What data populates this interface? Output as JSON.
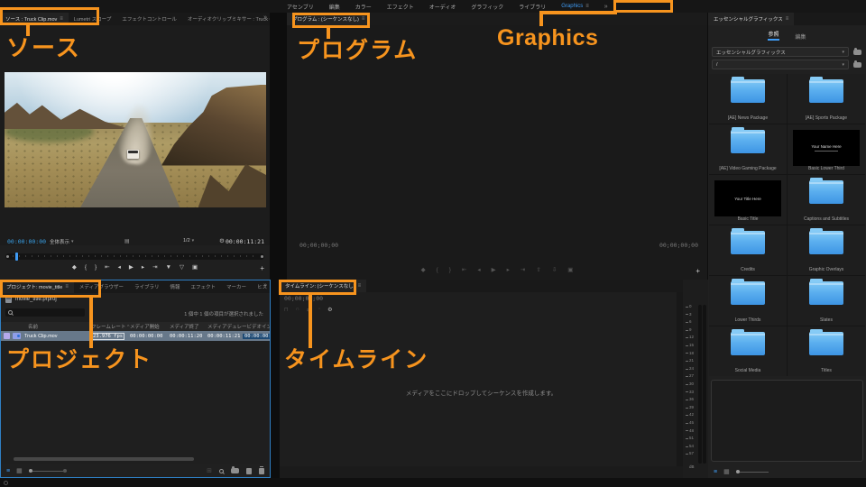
{
  "menu_bar": {
    "items": [
      "アセンブリ",
      "編集",
      "カラー",
      "エフェクト",
      "オーディオ",
      "グラフィック",
      "ライブラリ"
    ],
    "active_item": "Graphics"
  },
  "icons": {
    "menu": "≡",
    "overflow": "»",
    "chevron": "▾",
    "wrench": "⚙",
    "sort": "^",
    "captions": "▤",
    "list_view": "≡",
    "grid_view": "▦",
    "plus": "+"
  },
  "transport": {
    "marker": "◆",
    "mark_in": "{",
    "mark_out": "}",
    "go_to_in": "⇤",
    "step_back": "◂",
    "play": "▶",
    "step_forward": "▸",
    "go_to_out": "⇥",
    "insert": "▼",
    "overwrite": "▽",
    "lift": "⇧",
    "extract": "⇩",
    "export_frame": "▣"
  },
  "tools": [
    {
      "name": "selection-tool",
      "active": true
    },
    {
      "name": "track-select-forward-tool",
      "glyph": "⇥"
    },
    {
      "name": "ripple-edit-tool",
      "glyph": "↔"
    },
    {
      "name": "razor-tool",
      "glyph": "✂"
    },
    {
      "name": "slip-tool",
      "glyph": "⇆"
    },
    {
      "name": "pen-tool",
      "glyph": "✎"
    },
    {
      "name": "hand-tool",
      "glyph": "☝"
    },
    {
      "name": "type-tool",
      "glyph": "T"
    }
  ],
  "source_panel": {
    "tabs": [
      "ソース : Truck Clip.mov",
      "Lumetri スコープ",
      "エフェクトコントロール",
      "オーディオクリップミキサー : Truck Clip.m"
    ],
    "timecode": "00:00:00:00",
    "fit_select": "全体表示",
    "resolution_select": "1/2",
    "duration": "00:00:11:21"
  },
  "program_panel": {
    "tab": "プログラム : (シーケンスなし)",
    "timecode": "00;00;00;00",
    "duration": "00;00;00;00"
  },
  "project_panel": {
    "tabs": [
      "プロジェクト: movie_title",
      "メディアブラウザー",
      "ライブラリ",
      "情報",
      "エフェクト",
      "マーカー",
      "ヒス"
    ],
    "project_file": "movie_title.prproj",
    "selection_status": "1 個中 1 個の項目が選択されました",
    "columns": [
      "名前",
      "フレームレート",
      "メディア開始",
      "メディア終了",
      "メディアデュレー",
      "ビデオイン"
    ],
    "rows": [
      {
        "name": "Truck Clip.mov",
        "frame_rate": "23.976 fps",
        "media_start": "00:00:00:00",
        "media_end": "00:00:11:20",
        "media_duration": "00:00:11:21",
        "video_in": "00:00:00:0"
      }
    ]
  },
  "timeline_panel": {
    "tab": "タイムライン: (シーケンスなし)",
    "timecode": "00;00;00;00",
    "drop_message": "メディアをここにドロップしてシーケンスを作成します。",
    "icons": {
      "nest": "⊓",
      "snap": "∩",
      "link": "⇄",
      "marker": "◦"
    }
  },
  "audio_meter": {
    "ticks": [
      "0",
      "3",
      "6",
      "9",
      "12",
      "15",
      "18",
      "21",
      "24",
      "27",
      "30",
      "33",
      "36",
      "39",
      "42",
      "45",
      "48",
      "51",
      "54",
      "57"
    ],
    "unit": "dB"
  },
  "eg_panel": {
    "tab": "エッセンシャルグラフィックス",
    "browse_tab": "参照",
    "edit_tab": "編集",
    "library_select": "エッセンシャルグラフィックス",
    "path_select": "/",
    "items": [
      {
        "label": "[AE] News Package",
        "type": "folder"
      },
      {
        "label": "[AE] Sports Package",
        "type": "folder"
      },
      {
        "label": "[AE] Video Gaming Package",
        "type": "folder"
      },
      {
        "label": "Basic Lower Third",
        "type": "thumbnail",
        "thumb_text": "Your Name Here",
        "thumb_style": "lower-third"
      },
      {
        "label": "Basic Title",
        "type": "thumbnail",
        "thumb_text": "Your Title Here",
        "thumb_style": "title"
      },
      {
        "label": "Captions and Subtitles",
        "type": "folder"
      },
      {
        "label": "Credits",
        "type": "folder"
      },
      {
        "label": "Graphic Overlays",
        "type": "folder"
      },
      {
        "label": "Lower Thirds",
        "type": "folder"
      },
      {
        "label": "Slates",
        "type": "folder"
      },
      {
        "label": "Social Media",
        "type": "folder"
      },
      {
        "label": "Titles",
        "type": "folder"
      }
    ]
  },
  "annotations": {
    "color": "#F7941E",
    "source": "ソース",
    "program": "プログラム",
    "graphics": "Graphics",
    "project": "プロジェクト",
    "timeline": "タイムライン"
  },
  "colors": {
    "accent_blue": "#3F9BF4",
    "timecode_blue": "#39A0E6",
    "annotation_orange": "#F7941E",
    "folder_blue": "#5CB0EF",
    "selected_row": "#67788A"
  }
}
